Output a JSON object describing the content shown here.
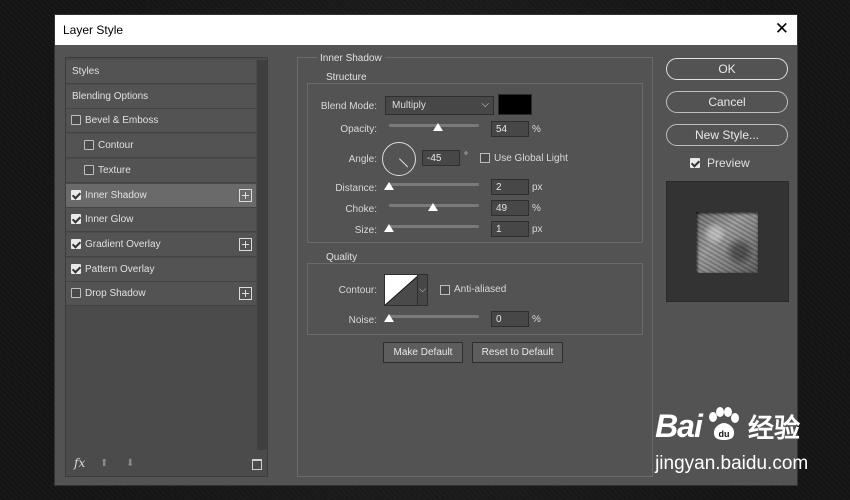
{
  "window": {
    "title": "Layer Style",
    "close_glyph": "✕"
  },
  "sidebar": {
    "items": [
      {
        "label": "Styles",
        "checkbox": null,
        "checked": false,
        "indent": false,
        "plus": false,
        "selected": false
      },
      {
        "label": "Blending Options",
        "checkbox": null,
        "checked": false,
        "indent": false,
        "plus": false,
        "selected": false
      },
      {
        "label": "Bevel & Emboss",
        "checkbox": true,
        "checked": false,
        "indent": false,
        "plus": false,
        "selected": false
      },
      {
        "label": "Contour",
        "checkbox": true,
        "checked": false,
        "indent": true,
        "plus": false,
        "selected": false
      },
      {
        "label": "Texture",
        "checkbox": true,
        "checked": false,
        "indent": true,
        "plus": false,
        "selected": false
      },
      {
        "label": "Inner Shadow",
        "checkbox": true,
        "checked": true,
        "indent": false,
        "plus": true,
        "selected": true
      },
      {
        "label": "Inner Glow",
        "checkbox": true,
        "checked": true,
        "indent": false,
        "plus": false,
        "selected": false
      },
      {
        "label": "Gradient Overlay",
        "checkbox": true,
        "checked": true,
        "indent": false,
        "plus": true,
        "selected": false
      },
      {
        "label": "Pattern Overlay",
        "checkbox": true,
        "checked": true,
        "indent": false,
        "plus": false,
        "selected": false
      },
      {
        "label": "Drop Shadow",
        "checkbox": true,
        "checked": false,
        "indent": false,
        "plus": true,
        "selected": false
      }
    ],
    "footer": {
      "fx": "fx",
      "up": "⬆",
      "down": "⬇"
    }
  },
  "panel": {
    "title": "Inner Shadow",
    "structure": {
      "title": "Structure",
      "blend_mode": {
        "label": "Blend Mode:",
        "value": "Multiply",
        "color": "#000000"
      },
      "opacity": {
        "label": "Opacity:",
        "value": "54",
        "unit": "%",
        "level": 0.54
      },
      "angle": {
        "label": "Angle:",
        "value": "-45",
        "unit": "°",
        "global_light_label": "Use Global Light",
        "global_light_checked": false
      },
      "distance": {
        "label": "Distance:",
        "value": "2",
        "unit": "px",
        "level": 0.0
      },
      "choke": {
        "label": "Choke:",
        "value": "49",
        "unit": "%",
        "level": 0.49
      },
      "size": {
        "label": "Size:",
        "value": "1",
        "unit": "px",
        "level": 0.0
      }
    },
    "quality": {
      "title": "Quality",
      "contour": {
        "label": "Contour:",
        "anti_aliased_label": "Anti-aliased",
        "anti_aliased_checked": false
      },
      "noise": {
        "label": "Noise:",
        "value": "0",
        "unit": "%",
        "level": 0.0
      }
    },
    "buttons": {
      "make_default": "Make Default",
      "reset_default": "Reset to Default"
    }
  },
  "actions": {
    "ok": "OK",
    "cancel": "Cancel",
    "new_style": "New Style...",
    "preview_label": "Preview",
    "preview_checked": true
  },
  "watermark": {
    "logo_left": "Bai",
    "logo_right": "经验",
    "url": "jingyan.baidu.com"
  }
}
